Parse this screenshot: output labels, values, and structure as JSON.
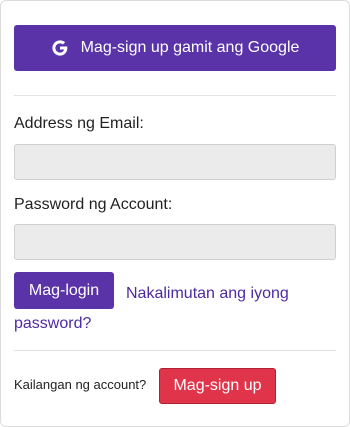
{
  "google_button": {
    "label": "Mag-sign up gamit ang Google",
    "icon": "google-icon"
  },
  "form": {
    "email_label": "Address ng Email:",
    "email_value": "",
    "password_label": "Password ng Account:",
    "password_value": "",
    "login_label": "Mag-login",
    "forgot_link": "Nakalimutan ang iyong password?"
  },
  "footer": {
    "need_account_text": "Kailangan ng account?",
    "signup_label": "Mag-sign up"
  },
  "colors": {
    "primary_purple": "#5a33a8",
    "link_purple": "#4e2aa0",
    "signup_red": "#e0344a",
    "input_bg": "#ebebeb"
  }
}
